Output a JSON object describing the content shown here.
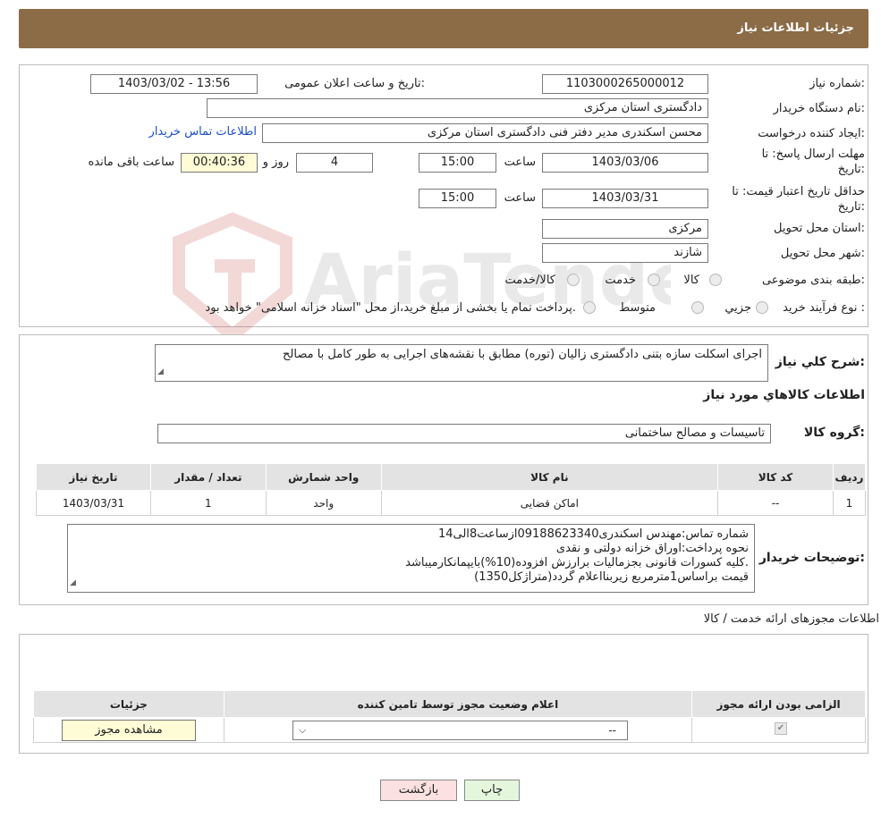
{
  "header": {
    "title": "جزئیات اطلاعات نیاز"
  },
  "details": {
    "need_number_label": "شماره نیاز:",
    "need_number": "1103000265000012",
    "announce_label": "تاریخ و ساعت اعلان عمومی:",
    "announce_value": "1403/03/02 - 13:56",
    "buyer_org_label": "نام دستگاه خریدار:",
    "buyer_org": "دادگستری استان مرکزی",
    "creator_label": "ایجاد کننده درخواست:",
    "creator": "محسن اسکندری مدیر دفتر فنی دادگستری استان مرکزی",
    "contact_link": "اطلاعات تماس خریدار",
    "reply_deadline_label": "مهلت ارسال پاسخ: تا تاریخ:",
    "reply_date": "1403/03/06",
    "time_label": "ساعت",
    "reply_time": "15:00",
    "days": "4",
    "days_label": "روز و",
    "remaining": "00:40:36",
    "remaining_label": "ساعت باقی مانده",
    "price_validity_label": "حداقل تاریخ اعتبار قیمت: تا تاریخ:",
    "price_date": "1403/03/31",
    "price_time": "15:00",
    "province_label": "استان محل تحویل:",
    "province": "مرکزی",
    "city_label": "شهر محل تحویل:",
    "city": "شازند",
    "category_label": "طبقه بندی موضوعی:",
    "category_options": [
      "کالا",
      "خدمت",
      "کالا/خدمت"
    ],
    "process_label": "نوع فرآیند خرید :",
    "process_options": [
      "جزیي",
      "متوسط"
    ],
    "process_note": "پرداخت تمام یا بخشی از مبلغ خرید،از محل \"اسناد خزانه اسلامی\" خواهد بود."
  },
  "summary": {
    "label": "شرح کلي نياز:",
    "text": "اجرای اسکلت سازه بتنی دادگستری زالیان (توره)  مطابق با نقشه‌های اجرایی به طور کامل با مصالح",
    "goods_title": "اطلاعات کالاهاي مورد نياز",
    "group_label": "گروه کالا:",
    "group_value": "تاسیسات و مصالح ساختمانی"
  },
  "goods_table": {
    "headers": [
      "ردیف",
      "کد کالا",
      "نام کالا",
      "واحد شمارش",
      "تعداد / مقدار",
      "تاریخ نیاز"
    ],
    "rows": [
      [
        "1",
        "--",
        "اماکن قضایی",
        "واحد",
        "1",
        "1403/03/31"
      ]
    ]
  },
  "buyer_notes": {
    "label": "توضیحات خریدار:",
    "lines": [
      "شماره تماس:مهندس اسکندری09188623340ازساعت8الی14",
      "نحوه پرداخت:اوراق خزانه دولتی و نقدی",
      "کلیه کسورات قانونی بجزمالیات برارزش افزوده(10%)بایپمانکارمیباشد.",
      "قیمت براساس1مترمربع زیربنااعلام گردد(متراژکل1350)"
    ]
  },
  "permits": {
    "title": "اطلاعات مجوزهای ارائه خدمت / کالا",
    "headers": [
      "الزامی بودن ارائه مجوز",
      "اعلام وضعیت مجوز توسط تامین کننده",
      "جزئیات"
    ],
    "select_value": "--",
    "view_button": "مشاهده مجوز"
  },
  "footer": {
    "print": "چاپ",
    "back": "بازگشت"
  },
  "watermark": {
    "text": "AriaTender.neT"
  }
}
